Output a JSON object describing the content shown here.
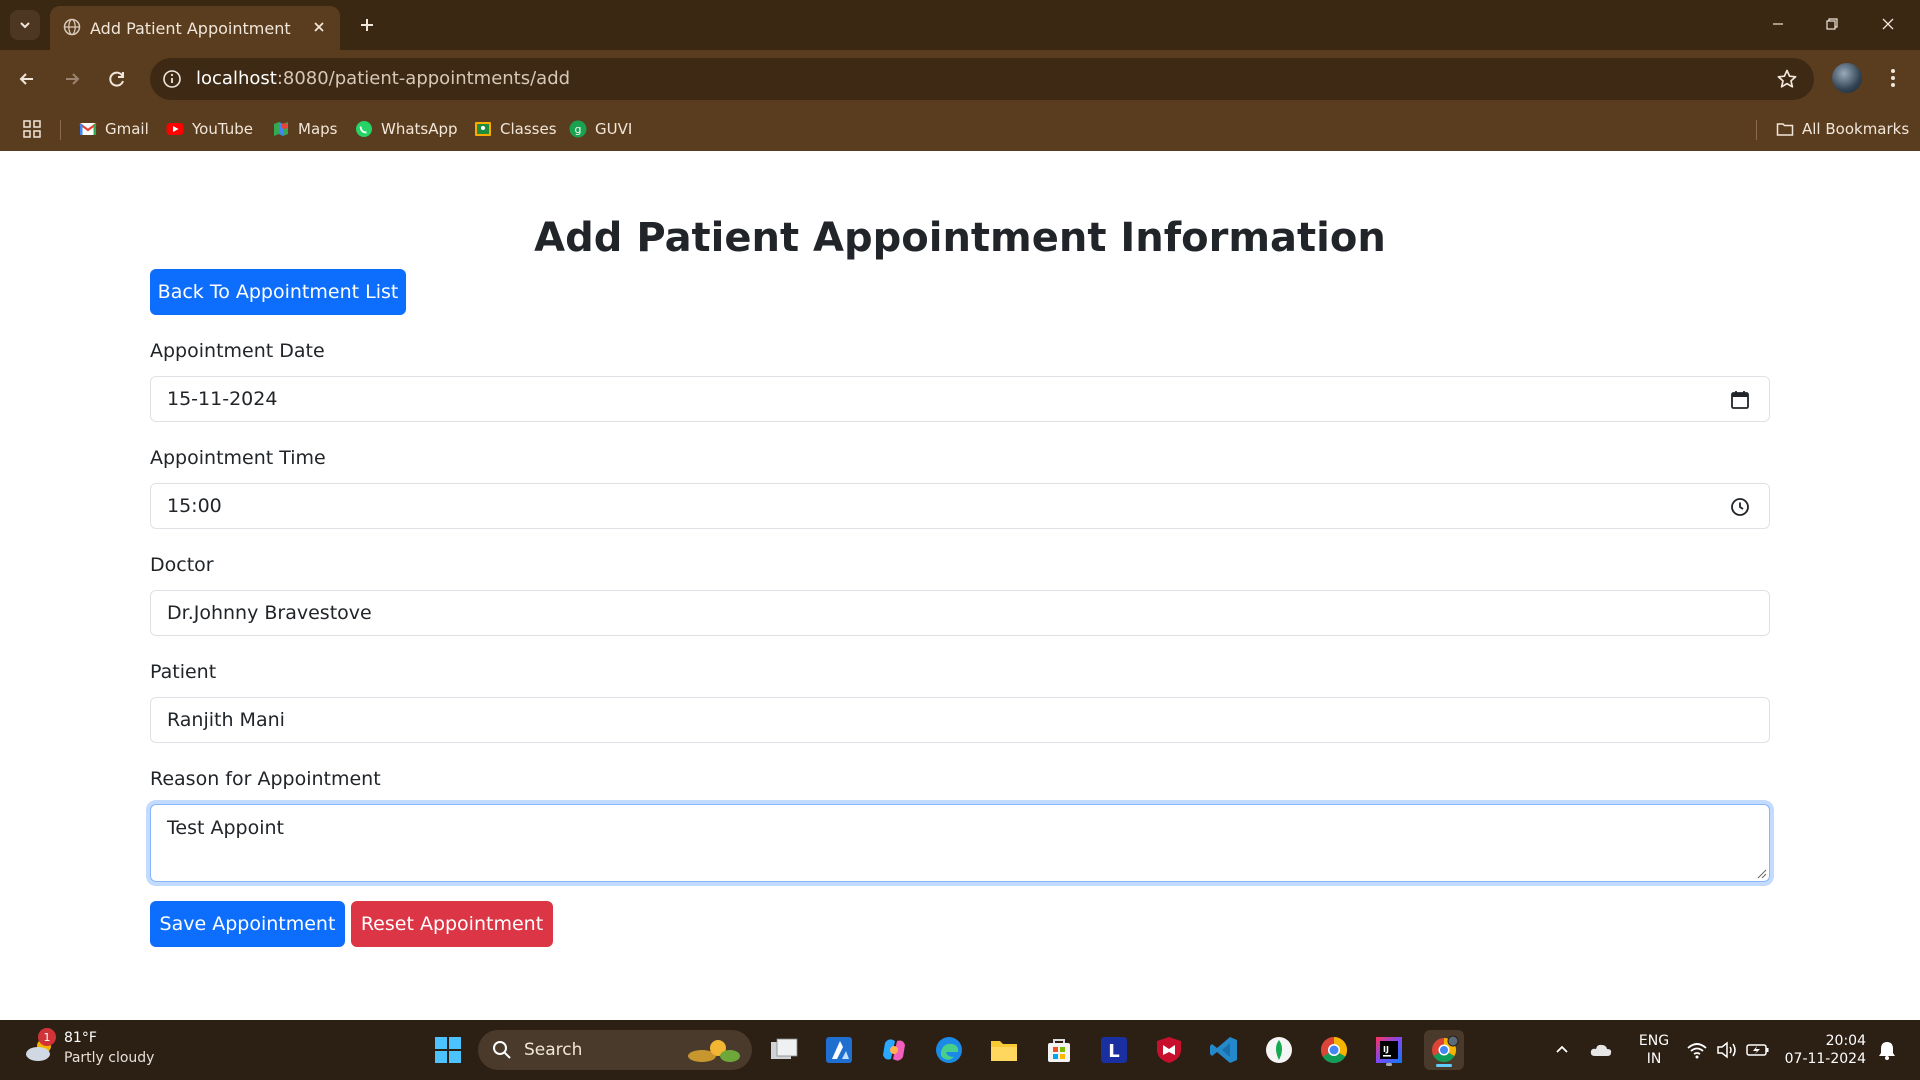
{
  "browser": {
    "tab_title": "Add Patient Appointment",
    "url_host": "localhost",
    "url_rest": ":8080/patient-appointments/add",
    "bookmarks": [
      "Gmail",
      "YouTube",
      "Maps",
      "WhatsApp",
      "Classes",
      "GUVI"
    ],
    "all_bookmarks": "All Bookmarks"
  },
  "page": {
    "title": "Add Patient Appointment Information",
    "back_button": "Back To Appointment List",
    "fields": {
      "date_label": "Appointment Date",
      "date_value": "15-11-2024",
      "time_label": "Appointment Time",
      "time_value": "15:00",
      "doctor_label": "Doctor",
      "doctor_value": "Dr.Johnny Bravestove",
      "patient_label": "Patient",
      "patient_value": "Ranjith Mani",
      "reason_label": "Reason for Appointment",
      "reason_value": "Test Appoint"
    },
    "save_button": "Save Appointment",
    "reset_button": "Reset Appointment"
  },
  "taskbar": {
    "weather_temp": "81°F",
    "weather_desc": "Partly cloudy",
    "weather_badge": "1",
    "search_placeholder": "Search",
    "lang_line1": "ENG",
    "lang_line2": "IN",
    "time": "20:04",
    "date": "07-11-2024"
  },
  "colors": {
    "primary": "#0d6efd",
    "danger": "#dc3545",
    "chrome_dark": "#3a2812",
    "chrome": "#5a3d1e"
  }
}
